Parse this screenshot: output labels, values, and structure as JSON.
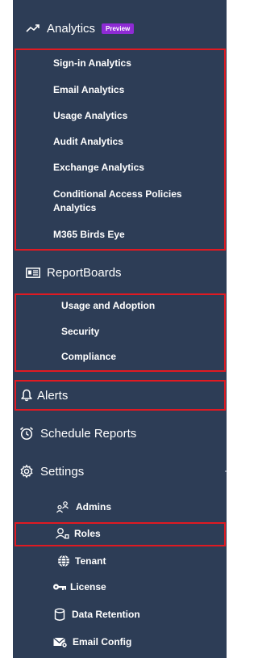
{
  "analytics": {
    "label": "Analytics",
    "badge": "Preview",
    "toggle": "−",
    "items": [
      "Sign-in Analytics",
      "Email Analytics",
      "Usage Analytics",
      "Audit Analytics",
      "Exchange Analytics",
      "Conditional Access Policies Analytics",
      "M365 Birds Eye"
    ]
  },
  "reportboards": {
    "label": "ReportBoards",
    "toggle": "−",
    "items": [
      "Usage and Adoption",
      "Security",
      "Compliance"
    ]
  },
  "alerts": {
    "label": "Alerts"
  },
  "schedule": {
    "label": "Schedule Reports"
  },
  "settings": {
    "label": "Settings",
    "toggle": "+",
    "items": [
      "Admins",
      "Roles",
      "Tenant",
      "License",
      "Data Retention",
      "Email Config"
    ]
  },
  "colors": {
    "sidebar_bg": "#2d3d56",
    "highlight_border": "#e01a22",
    "badge_bg": "#8e2bd4"
  }
}
